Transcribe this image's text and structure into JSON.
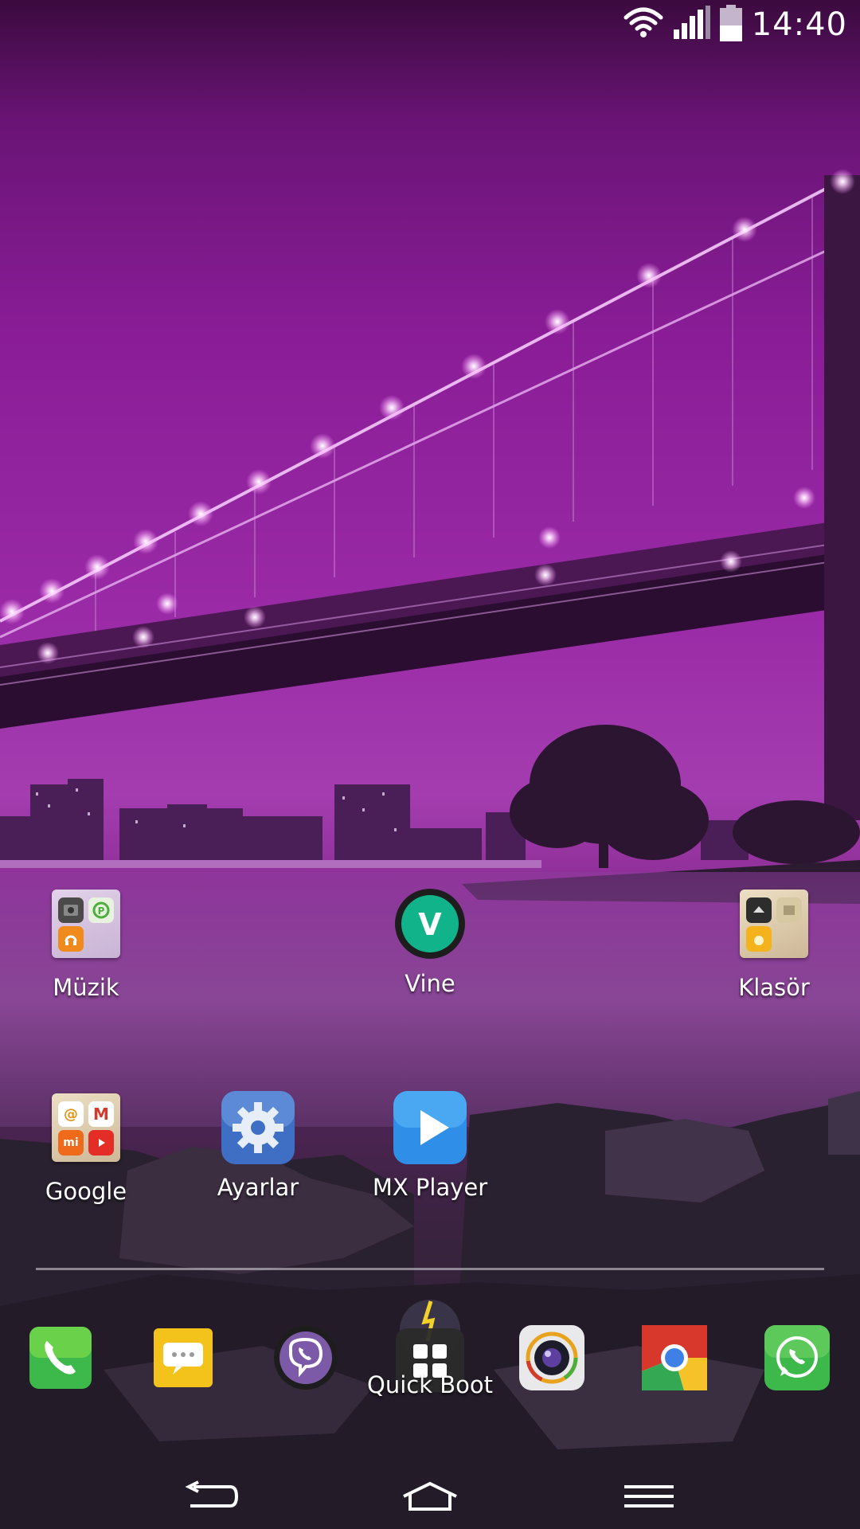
{
  "status_bar": {
    "time": "14:40",
    "icons": [
      "wifi-icon",
      "signal-icon",
      "battery-icon"
    ]
  },
  "home": {
    "row1": [
      {
        "label": "Müzik",
        "type": "folder",
        "icon": "music-folder-icon"
      },
      {
        "label": "Vine",
        "type": "app",
        "icon": "vine-icon"
      },
      {
        "label": "Klasör",
        "type": "folder",
        "icon": "folder-icon"
      }
    ],
    "row2": [
      {
        "label": "Google",
        "type": "folder",
        "icon": "google-folder-icon"
      },
      {
        "label": "Ayarlar",
        "type": "app",
        "icon": "settings-gear-icon"
      },
      {
        "label": "MX Player",
        "type": "app",
        "icon": "mx-player-play-icon"
      }
    ]
  },
  "dock": {
    "items": [
      {
        "icon": "phone-icon"
      },
      {
        "icon": "messages-icon"
      },
      {
        "icon": "viber-icon"
      },
      {
        "icon": "quick-boot-icon",
        "label": "Quick Boot"
      },
      {
        "icon": "camera-icon"
      },
      {
        "icon": "chrome-icon"
      },
      {
        "icon": "whatsapp-icon"
      }
    ]
  },
  "nav_bar": {
    "buttons": [
      "back-icon",
      "home-icon",
      "menu-icon"
    ]
  },
  "colors": {
    "sky": "#9a2aa6",
    "settings_blue": "#3f6fc4",
    "mx_blue": "#2f8fe8",
    "vine_green": "#11b48a",
    "whatsapp_green": "#3db84a"
  }
}
